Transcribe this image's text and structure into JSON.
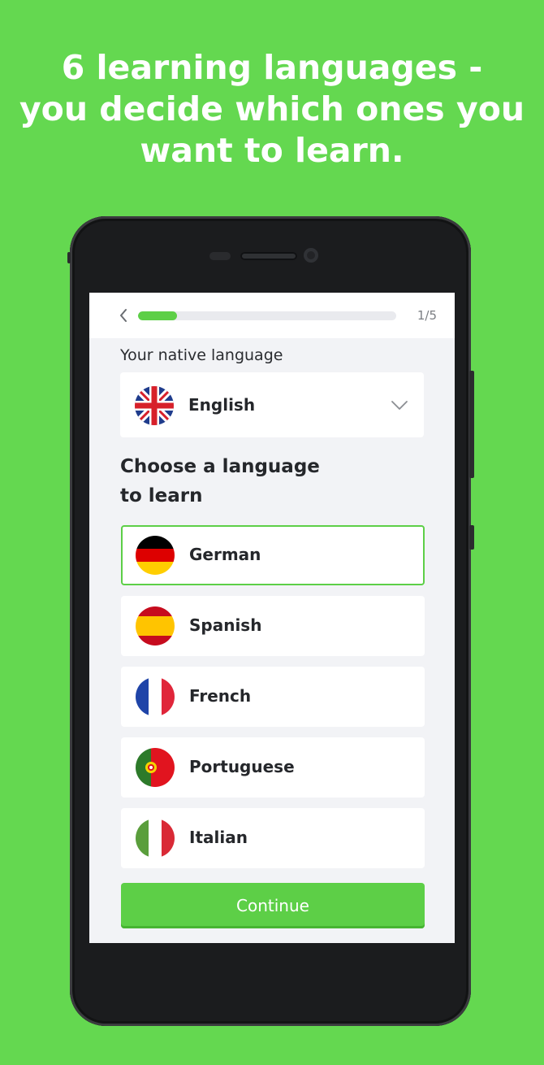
{
  "headline": {
    "line1": "6 learning languages -",
    "line2": "you decide which ones you",
    "line3": "want to learn."
  },
  "progress": {
    "step_text": "1/5",
    "fraction": 0.15
  },
  "native": {
    "label": "Your native language",
    "value": "English",
    "flag_icon": "uk-flag-icon"
  },
  "choose": {
    "line1": "Choose a language",
    "line2": "to learn"
  },
  "languages": [
    {
      "name": "German",
      "selected": true,
      "flag_icon": "germany-flag-icon"
    },
    {
      "name": "Spanish",
      "selected": false,
      "flag_icon": "spain-flag-icon"
    },
    {
      "name": "French",
      "selected": false,
      "flag_icon": "france-flag-icon"
    },
    {
      "name": "Portuguese",
      "selected": false,
      "flag_icon": "portugal-flag-icon"
    },
    {
      "name": "Italian",
      "selected": false,
      "flag_icon": "italy-flag-icon"
    }
  ],
  "continue_label": "Continue",
  "colors": {
    "accent": "#5dcf47",
    "background": "#64d850"
  }
}
